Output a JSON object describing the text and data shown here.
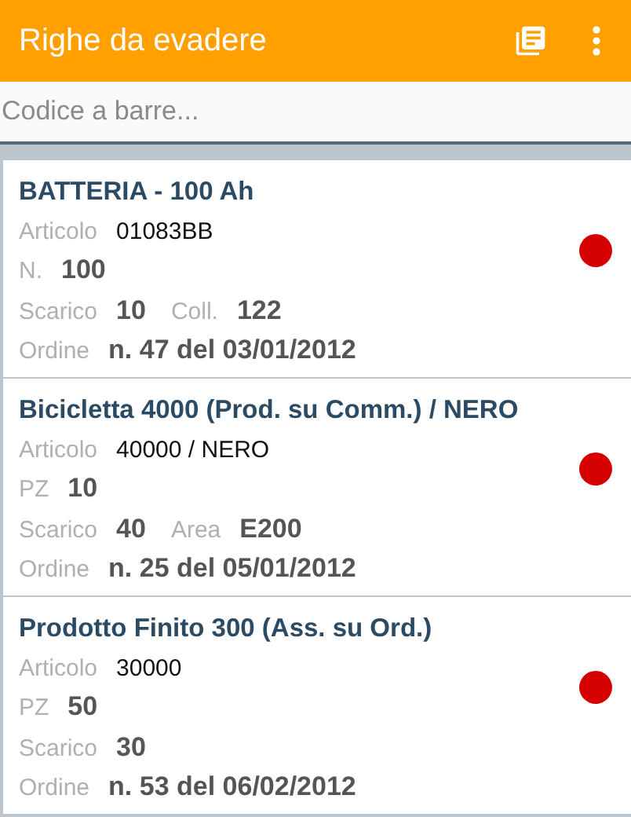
{
  "app_bar": {
    "title": "Righe da evadere"
  },
  "search": {
    "placeholder": "Codice a barre..."
  },
  "items": [
    {
      "title": "BATTERIA - 100 Ah",
      "color": "#d50000",
      "rows": [
        [
          {
            "label": "Articolo",
            "value": "01083BB",
            "kind": "code"
          }
        ],
        [
          {
            "label": "N.",
            "value": "100",
            "kind": "bold"
          }
        ],
        [
          {
            "label": "Scarico",
            "value": "10",
            "kind": "bold"
          },
          {
            "label": "Coll.",
            "value": "122",
            "kind": "bold"
          }
        ],
        [
          {
            "label": "Ordine",
            "value": "n. 47 del 03/01/2012",
            "kind": "bold"
          }
        ]
      ]
    },
    {
      "title": "Bicicletta 4000 (Prod. su Comm.) / NERO",
      "color": "#d50000",
      "rows": [
        [
          {
            "label": "Articolo",
            "value": "40000 / NERO",
            "kind": "code"
          }
        ],
        [
          {
            "label": "PZ",
            "value": "10",
            "kind": "bold"
          }
        ],
        [
          {
            "label": "Scarico",
            "value": "40",
            "kind": "bold"
          },
          {
            "label": "Area",
            "value": "E200",
            "kind": "bold"
          }
        ],
        [
          {
            "label": "Ordine",
            "value": "n. 25 del 05/01/2012",
            "kind": "bold"
          }
        ]
      ]
    },
    {
      "title": "Prodotto Finito 300 (Ass. su Ord.)",
      "color": "#d50000",
      "rows": [
        [
          {
            "label": "Articolo",
            "value": "30000",
            "kind": "code"
          }
        ],
        [
          {
            "label": "PZ",
            "value": "50",
            "kind": "bold"
          }
        ],
        [
          {
            "label": "Scarico",
            "value": "30",
            "kind": "bold"
          }
        ],
        [
          {
            "label": "Ordine",
            "value": "n. 53 del 06/02/2012",
            "kind": "bold"
          }
        ]
      ]
    }
  ]
}
